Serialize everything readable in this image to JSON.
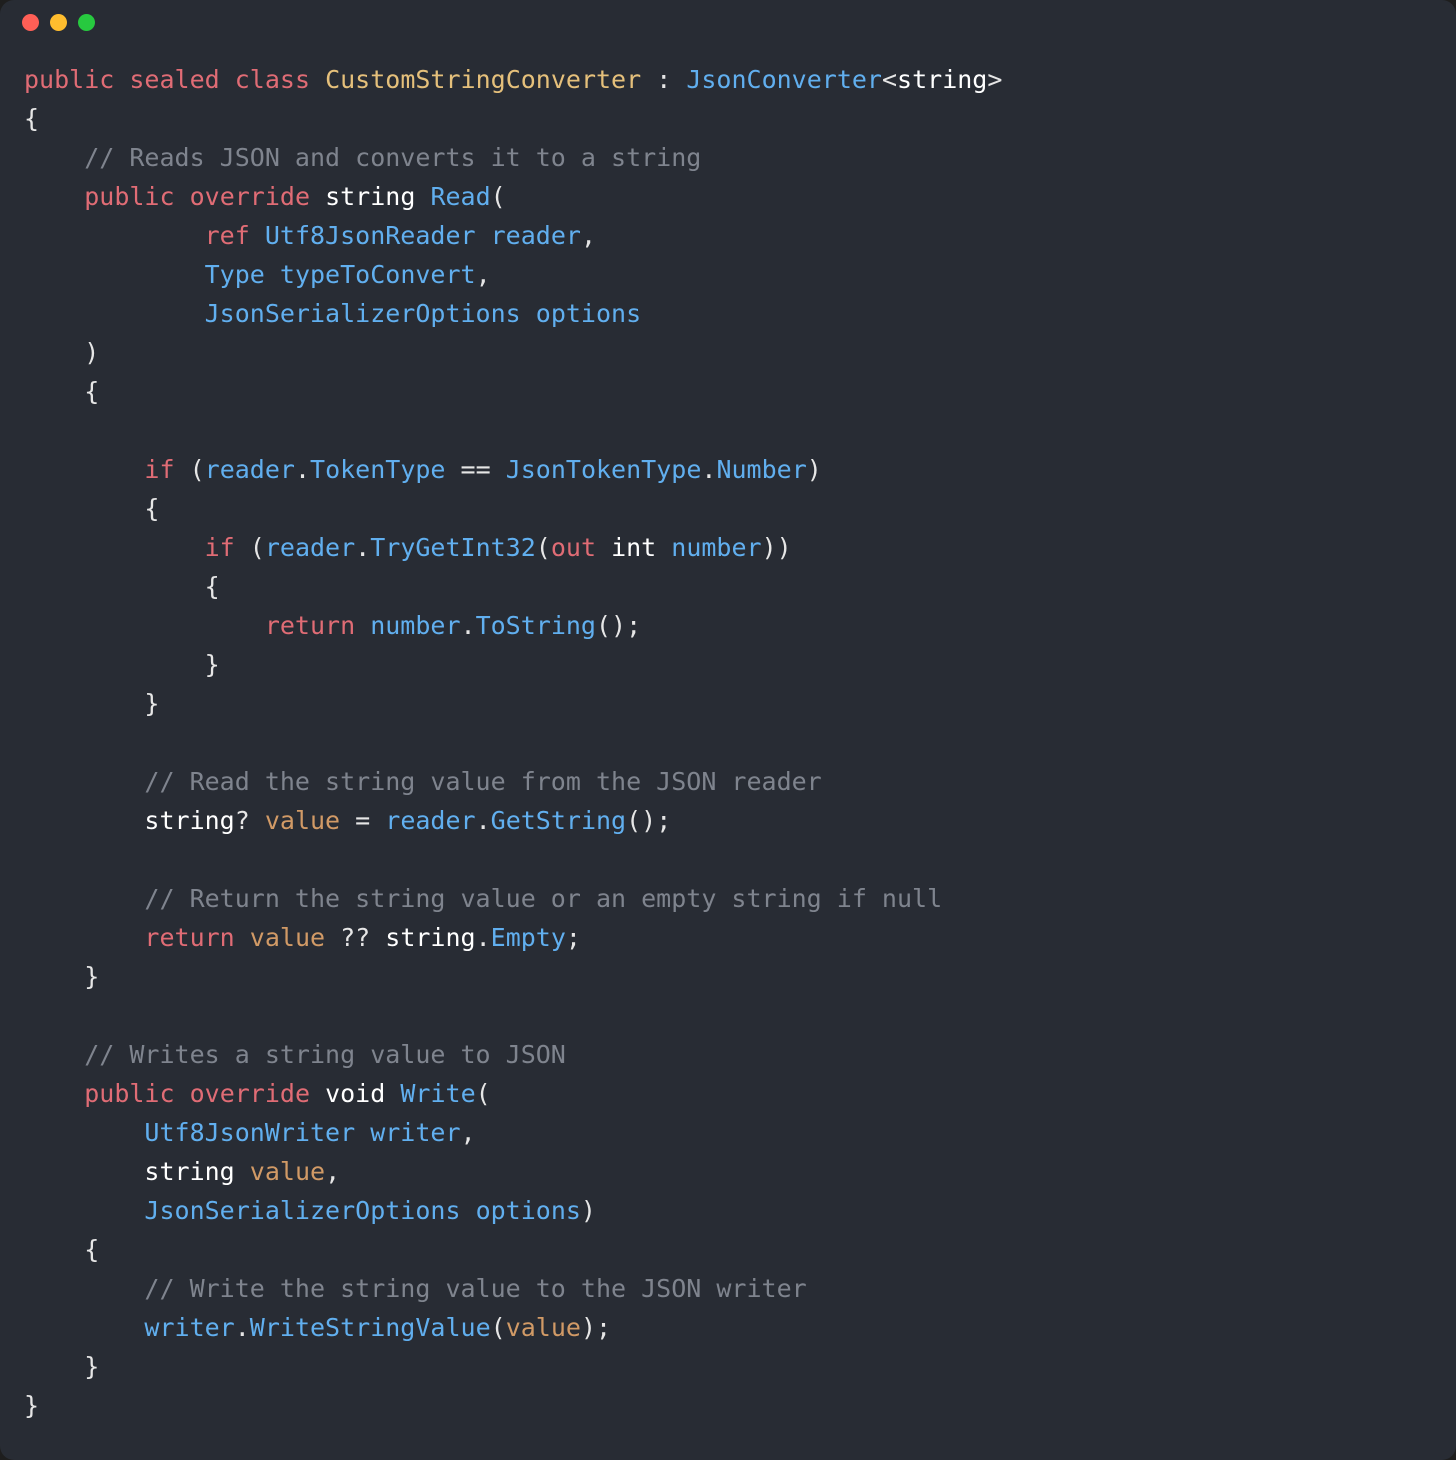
{
  "titlebar": {
    "dots": [
      "red",
      "yellow",
      "green"
    ]
  },
  "code": {
    "l1_public": "public",
    "l1_sealed": "sealed",
    "l1_class": "class",
    "l1_name": "CustomStringConverter",
    "l1_colon": " : ",
    "l1_base": "JsonConverter",
    "l1_open_angle": "<",
    "l1_generic": "string",
    "l1_close_angle": ">",
    "l2_brace": "{",
    "l3_cmt": "// Reads JSON and converts it to a string",
    "l4_public": "public",
    "l4_override": "override",
    "l4_string": "string",
    "l4_read": "Read",
    "l4_paren": "(",
    "l5_ref": "ref",
    "l5_type": "Utf8JsonReader",
    "l5_param": "reader",
    "l5_comma": ",",
    "l6_type": "Type",
    "l6_param": "typeToConvert",
    "l6_comma": ",",
    "l7_type": "JsonSerializerOptions",
    "l7_param": "options",
    "l8_paren": ")",
    "l9_brace": "{",
    "l10_if": "if",
    "l10_paren1": " (",
    "l10_reader": "reader",
    "l10_dot1": ".",
    "l10_tokentype": "TokenType",
    "l10_eq": " == ",
    "l10_jtt": "JsonTokenType",
    "l10_dot2": ".",
    "l10_number": "Number",
    "l10_paren2": ")",
    "l11_brace": "{",
    "l12_if": "if",
    "l12_paren1": " (",
    "l12_reader": "reader",
    "l12_dot": ".",
    "l12_trygetint": "TryGetInt32",
    "l12_paren2": "(",
    "l12_out": "out",
    "l12_int": " int ",
    "l12_number": "number",
    "l12_paren3": "))",
    "l13_brace": "{",
    "l14_return": "return",
    "l14_number": " number",
    "l14_dot": ".",
    "l14_tostring": "ToString",
    "l14_parens": "();",
    "l15_brace": "}",
    "l16_brace": "}",
    "l17_cmt": "// Read the string value from the JSON reader",
    "l18_string": "string",
    "l18_q": "? ",
    "l18_value": "value",
    "l18_eq": " = ",
    "l18_reader": "reader",
    "l18_dot": ".",
    "l18_getstring": "GetString",
    "l18_parens": "();",
    "l19_cmt": "// Return the string value or an empty string if null",
    "l20_return": "return",
    "l20_value": " value",
    "l20_coalesce": " ?? ",
    "l20_string": "string",
    "l20_dot": ".",
    "l20_empty": "Empty",
    "l20_semi": ";",
    "l21_brace": "}",
    "l22_cmt": "// Writes a string value to JSON",
    "l23_public": "public",
    "l23_override": "override",
    "l23_void": "void",
    "l23_write": "Write",
    "l23_paren": "(",
    "l24_type": "Utf8JsonWriter",
    "l24_param": "writer",
    "l24_comma": ",",
    "l25_string": "string",
    "l25_value": "value",
    "l25_comma": ",",
    "l26_type": "JsonSerializerOptions",
    "l26_param": "options",
    "l26_paren": ")",
    "l27_brace": "{",
    "l28_cmt": "// Write the string value to the JSON writer",
    "l29_writer": "writer",
    "l29_dot": ".",
    "l29_wsv": "WriteStringValue",
    "l29_paren1": "(",
    "l29_value": "value",
    "l29_paren2": ");",
    "l30_brace": "}",
    "l31_brace": "}"
  }
}
